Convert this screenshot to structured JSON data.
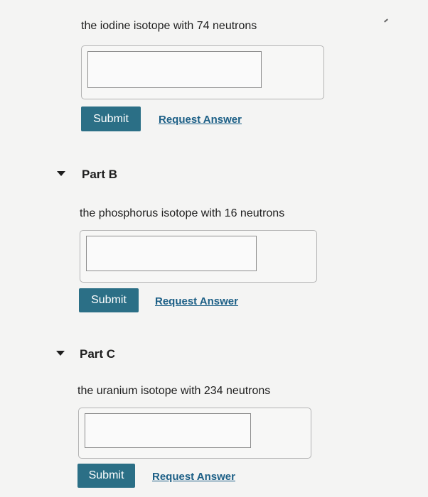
{
  "parts": [
    {
      "title": "",
      "prompt": "the iodine isotope with 74 neutrons",
      "answer_value": "",
      "submit_label": "Submit",
      "request_label": "Request Answer"
    },
    {
      "title": "Part B",
      "prompt": "the phosphorus isotope with 16 neutrons",
      "answer_value": "",
      "submit_label": "Submit",
      "request_label": "Request Answer"
    },
    {
      "title": "Part C",
      "prompt": "the uranium isotope with 234 neutrons",
      "answer_value": "",
      "submit_label": "Submit",
      "request_label": "Request Answer"
    }
  ],
  "icons": {
    "collapse": "caret-down-icon"
  },
  "colors": {
    "submit_bg": "#2b6f86",
    "link": "#1c5f86"
  }
}
